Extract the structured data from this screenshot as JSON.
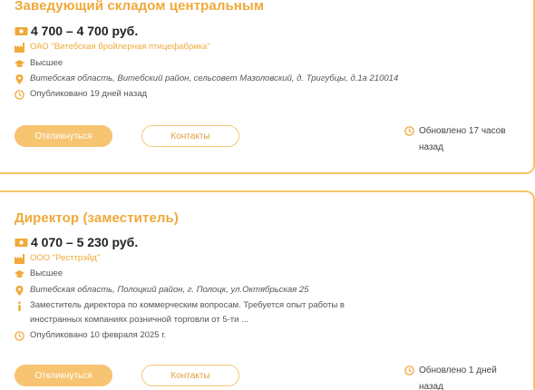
{
  "vacancies": [
    {
      "title": "Заведующий складом центральным",
      "salary": "4 700 – 4 700 руб.",
      "company": "ОАО \"Витебская бройлерная птицефабрика\"",
      "education": "Высшее",
      "address": "Витебская область, Витебский район, сельсовет Мазоловский, д. Тригубцы, д.1а 210014",
      "published": "Опубликовано 19 дней назад",
      "apply_label": "Откликнуться",
      "contacts_label": "Контакты",
      "updated": "Обновлено 17 часов назад"
    },
    {
      "title": "Директор (заместитель)",
      "salary": "4 070 – 5 230 руб.",
      "company": "ООО \"Ресттрэйд\"",
      "education": "Высшее",
      "address": "Витебская область, Полоцкий район, г. Полоцк, ул.Октябрьская 25",
      "description": "Заместитель директора по коммерческим вопросам. Требуется опыт работы в иностранных компаниях розничной торговли от 5-ти ...",
      "published": "Опубликовано 10 февраля 2025 г.",
      "apply_label": "Откликнуться",
      "contacts_label": "Контакты",
      "updated": "Обновлено 1 дней назад"
    }
  ],
  "colors": {
    "accent": "#f0a93a",
    "button_fill": "#f7c472",
    "border": "#f5c468"
  },
  "icons": [
    "money-icon",
    "factory-icon",
    "graduation-cap-icon",
    "location-pin-icon",
    "info-icon",
    "clock-icon"
  ]
}
